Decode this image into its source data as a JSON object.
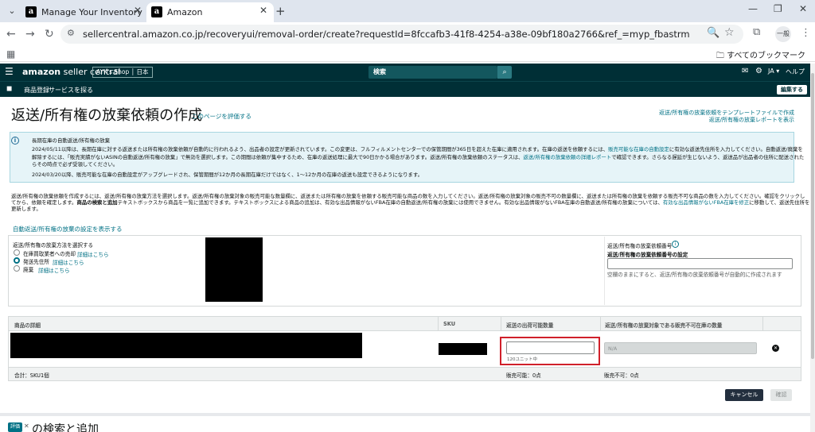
{
  "browser": {
    "tabs": [
      {
        "title": "Manage Your Inventory",
        "icon": "amazon-favicon",
        "active": false
      },
      {
        "title": "Amazon",
        "icon": "amazon-favicon",
        "active": true
      }
    ],
    "url": "sellercentral.amazon.co.jp/recoveryui/removal-order/create?requestId=8fccafb3-41f8-4254-a38e-09bf180a2766&ref_=myp_fbastrm",
    "all_bookmarks": "すべてのブックマーク",
    "profile": "一般",
    "favicon_letter": "a",
    "glyphs": {
      "menu": "⌄",
      "close": "✕",
      "new_tab": "+",
      "back": "←",
      "forward": "→",
      "reload": "↻",
      "tune": "⚙",
      "zoom": "🔍",
      "star": "☆",
      "extensions": "⧉",
      "kebab": "⋮",
      "apps": "▦",
      "folder": "🗀",
      "minimize": "—",
      "restore": "❐"
    }
  },
  "header": {
    "logo_bold": "amazon",
    "logo_light": " seller central",
    "shop_selector": "AYK's Shop │ 日本",
    "search_placeholder": "検索",
    "lang": "JA ▾",
    "help": "ヘルプ",
    "glyphs": {
      "menu": "☰",
      "search": "⌕",
      "mail": "✉",
      "settings": "⚙",
      "bookmark": "◼"
    }
  },
  "subnav": {
    "links": [
      "商品登録",
      "サービスを探る"
    ],
    "edit_button": "編集する"
  },
  "page": {
    "title": "返送/所有権の放棄依頼の作成",
    "learn_more": "このページを評価する",
    "top_links": [
      "返送/所有権の放棄依頼をテンプレートファイルで作成",
      "返送/所有権の放棄レポートを表示"
    ]
  },
  "info": {
    "heading": "長期在庫の自動返送/所有権の放棄",
    "line1": "2024/05/11以降は、長期在庫に対する返送または所有権の放棄依頼が自動的に行われるよう、出品者の設定が更新されています。この変更は、フルフィルメントセンターでの保管期間が365日を超えた在庫に適用されます。在庫の返送を依頼するには、",
    "line1_link": "販売可能な在庫の自動設定",
    "line1_end": "に有効な返送先住所を入力してください。自動返送/廃棄を",
    "line2": "解除するには、「販売実績がないASINの自動返送/所有権の放棄」で無効を選択します。この期間は依頼が集中するため、在庫の返送処理に最大で90日かかる場合があります。返送/所有権の放棄依頼のステータスは、",
    "line2_link": "返送/所有権の放棄依頼の詳細レポート",
    "line2_end": "で確認できます。さらなる遅延が生じないよう、返送品が出品者の住所に配送された",
    "line3": "らその時点で必ず受領してください。",
    "line4": "2024/03/20以降、販売可能な在庫の自動設定がアップグレードされ、保管期間が12か月の長期在庫だけではなく、1〜12か月の在庫の返送も設定できるようになります。"
  },
  "description": {
    "line1": "返送/所有権の放棄依頼を作成するには、返送/所有権の放棄方法を選択します。返送/所有権の放棄対象の販売可能な数量欄に、返送または所有権の放棄を依頼する販売可能な商品の数を入力してください。返送/所有権の放棄対象の販売不可の数量欄に、返送または所有権の放棄を依頼する販売不可な商品の数を入力してください。確認をクリックし",
    "line2_a": "てから、依頼を確定します。",
    "line2_b": "商品の検索と追加",
    "line2_c": "テキストボックスから商品を一覧に追加できます。テキストボックスによる商品の追加は、有効な出品情報がないFBA在庫の自動返送/所有権の放棄には使用できません。有効な出品情報がないFBA在庫の自動返送/所有権の放棄については、",
    "line2_link": "有効な出品情報がないFBA在庫を修正",
    "line2_d": "に移動して、返送先住所を",
    "line3": "更新します。"
  },
  "settings_link": "自動返送/所有権の放棄の設定を表示する",
  "method_panel": {
    "label": "返送/所有権の放棄方法を選択する",
    "options": [
      {
        "label": "在庫買取業者への売却",
        "detail": "詳細はこちら",
        "selected": false
      },
      {
        "label": "発送先住所",
        "detail": "詳細はこちら",
        "selected": true
      },
      {
        "label": "廃棄",
        "detail": "詳細はこちら",
        "selected": false
      }
    ]
  },
  "order_id_panel": {
    "label": "返送/所有権の放棄依頼番号",
    "help_icon": "i",
    "setting_label": "返送/所有権の放棄依頼番号の設定",
    "input_value": "",
    "hint": "空欄のままにすると、返送/所有権の放棄依頼番号が自動的に作成されます"
  },
  "table": {
    "headers": [
      "商品の詳細",
      "SKU",
      "返送の出荷可能数量",
      "返送/所有権の放棄対象である販売不可在庫の数量"
    ],
    "row": {
      "sellable_qty_value": "",
      "sellable_hint": "120ユニット中",
      "unsellable_qty_placeholder": "N/A",
      "remove_icon": "✕"
    },
    "footer": {
      "total": "合計：SKU1個",
      "sellable_total": "販売可能：0点",
      "unsellable_total": "販売不可：0点"
    }
  },
  "buttons": {
    "cancel": "キャンセル",
    "confirm": "確認"
  },
  "bottom_section": {
    "badge": "評価",
    "badge_close": "✕",
    "title": "の検索と追加"
  },
  "colors": {
    "header_bg": "#002f36",
    "link": "#007185",
    "highlight_box": "#d0202a",
    "info_bg": "#e6f4f8",
    "primary_button": "#232f3e"
  }
}
